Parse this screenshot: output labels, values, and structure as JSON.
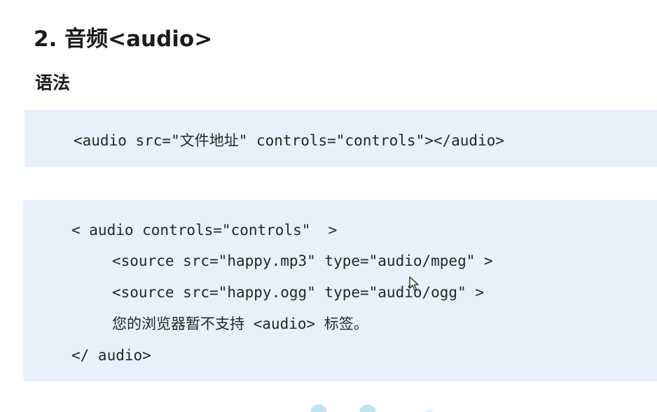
{
  "section": {
    "title": "2. 音频<audio>",
    "syntax_label": "语法"
  },
  "code_block_1": {
    "lines": [
      "<audio src=\"文件地址\" controls=\"controls\"></audio>"
    ]
  },
  "code_block_2": {
    "lines": [
      "< audio controls=\"controls\"  >",
      "<source src=\"happy.mp3\" type=\"audio/mpeg\" >",
      "<source src=\"happy.ogg\" type=\"audio/ogg\" >",
      "您的浏览器暂不支持 <audio> 标签。",
      "</ audio>"
    ]
  },
  "icons": {
    "cursor": "mouse-pointer-icon"
  }
}
